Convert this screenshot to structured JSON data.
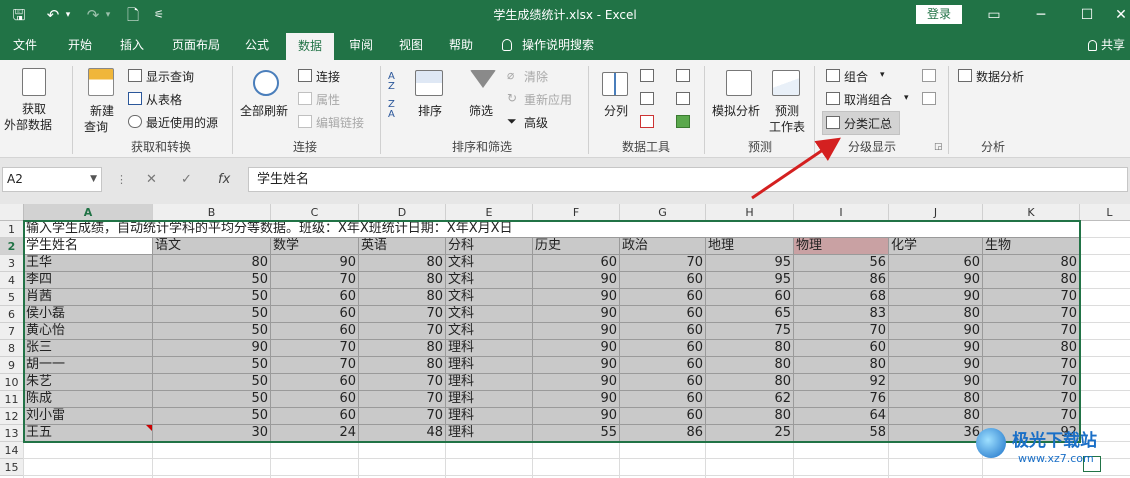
{
  "titlebar": {
    "doc_title": "学生成绩统计.xlsx  -  Excel",
    "login": "登录",
    "qa": {
      "save": "🖫",
      "undo": "↶",
      "undo_more": "▾",
      "redo": "↷",
      "redo_more": "▾",
      "preview": "🗋",
      "customize": "⚟"
    },
    "controls": {
      "display": "▭",
      "minimize": "─",
      "maximize": "☐",
      "close": "✕"
    }
  },
  "tabs": [
    {
      "label": "文件"
    },
    {
      "label": "开始"
    },
    {
      "label": "插入"
    },
    {
      "label": "页面布局"
    },
    {
      "label": "公式"
    },
    {
      "label": "数据"
    },
    {
      "label": "审阅"
    },
    {
      "label": "视图"
    },
    {
      "label": "帮助"
    }
  ],
  "tellme": "操作说明搜索",
  "share": "共享",
  "ribbon": {
    "get_data": [
      "获取",
      "外部数据"
    ],
    "new_query": [
      "新建",
      "查询"
    ],
    "show_query": "显示查询",
    "from_table": "从表格",
    "recent_sources": "最近使用的源",
    "group_get_transform": "获取和转换",
    "refresh_all": "全部刷新",
    "connections": "连接",
    "properties": "属性",
    "edit_links": "编辑链接",
    "group_connections": "连接",
    "sort": "排序",
    "filter": "筛选",
    "clear": "清除",
    "reapply": "重新应用",
    "advanced": "高级",
    "group_sort_filter": "排序和筛选",
    "split": "分列",
    "group_data_tools": "数据工具",
    "whatif": "模拟分析",
    "forecast": [
      "预测",
      "工作表"
    ],
    "group_forecast": "预测",
    "group": "组合",
    "ungroup": "取消组合",
    "subtotal": "分类汇总",
    "group_outline": "分级显示",
    "data_analysis": "数据分析",
    "group_analysis": "分析",
    "sort_az": "A Z",
    "sort_za": "Z A"
  },
  "formula_bar": {
    "cell_ref": "A2",
    "content": "学生姓名",
    "cancel": "✕",
    "enter": "✓",
    "fx": "fx"
  },
  "sheet": {
    "columns": [
      "A",
      "B",
      "C",
      "D",
      "E",
      "F",
      "G",
      "H",
      "I",
      "J",
      "K",
      "L"
    ],
    "row_numbers": [
      "1",
      "2",
      "3",
      "4",
      "5",
      "6",
      "7",
      "8",
      "9",
      "10",
      "11",
      "12",
      "13",
      "14",
      "15"
    ],
    "title_row": "输入学生成绩，自动统计学科的平均分等数据。班级：X年X班统计日期：X年X月X日",
    "header": [
      "学生姓名",
      "语文",
      "数学",
      "英语",
      "分科",
      "历史",
      "政治",
      "地理",
      "物理",
      "化学",
      "生物"
    ],
    "rows": [
      [
        "王华",
        "80",
        "90",
        "80",
        "文科",
        "60",
        "70",
        "95",
        "56",
        "60",
        "80"
      ],
      [
        "李四",
        "50",
        "70",
        "80",
        "文科",
        "90",
        "60",
        "95",
        "86",
        "90",
        "80"
      ],
      [
        "肖茜",
        "50",
        "60",
        "80",
        "文科",
        "90",
        "60",
        "60",
        "68",
        "90",
        "70"
      ],
      [
        "侯小磊",
        "50",
        "60",
        "70",
        "文科",
        "90",
        "60",
        "65",
        "83",
        "80",
        "70"
      ],
      [
        "黄心怡",
        "50",
        "60",
        "70",
        "文科",
        "90",
        "60",
        "75",
        "70",
        "90",
        "70"
      ],
      [
        "张三",
        "90",
        "70",
        "80",
        "理科",
        "90",
        "60",
        "80",
        "60",
        "90",
        "80"
      ],
      [
        "胡一一",
        "50",
        "70",
        "80",
        "理科",
        "90",
        "60",
        "80",
        "80",
        "90",
        "70"
      ],
      [
        "朱艺",
        "50",
        "60",
        "70",
        "理科",
        "90",
        "60",
        "80",
        "92",
        "90",
        "70"
      ],
      [
        "陈成",
        "50",
        "60",
        "70",
        "理科",
        "90",
        "60",
        "62",
        "76",
        "80",
        "70"
      ],
      [
        "刘小雷",
        "50",
        "60",
        "70",
        "理科",
        "90",
        "60",
        "80",
        "64",
        "80",
        "70"
      ],
      [
        "王五",
        "30",
        "24",
        "48",
        "理科",
        "55",
        "86",
        "25",
        "58",
        "36",
        "92"
      ]
    ]
  },
  "watermark": {
    "name": "极光下载站",
    "url": "www.xz7.com"
  },
  "colors": {
    "excel_green": "#217346",
    "cell_fill": "#c9c9c9",
    "highlight_fill": "#c9a1a3",
    "arrow": "#d42020"
  }
}
